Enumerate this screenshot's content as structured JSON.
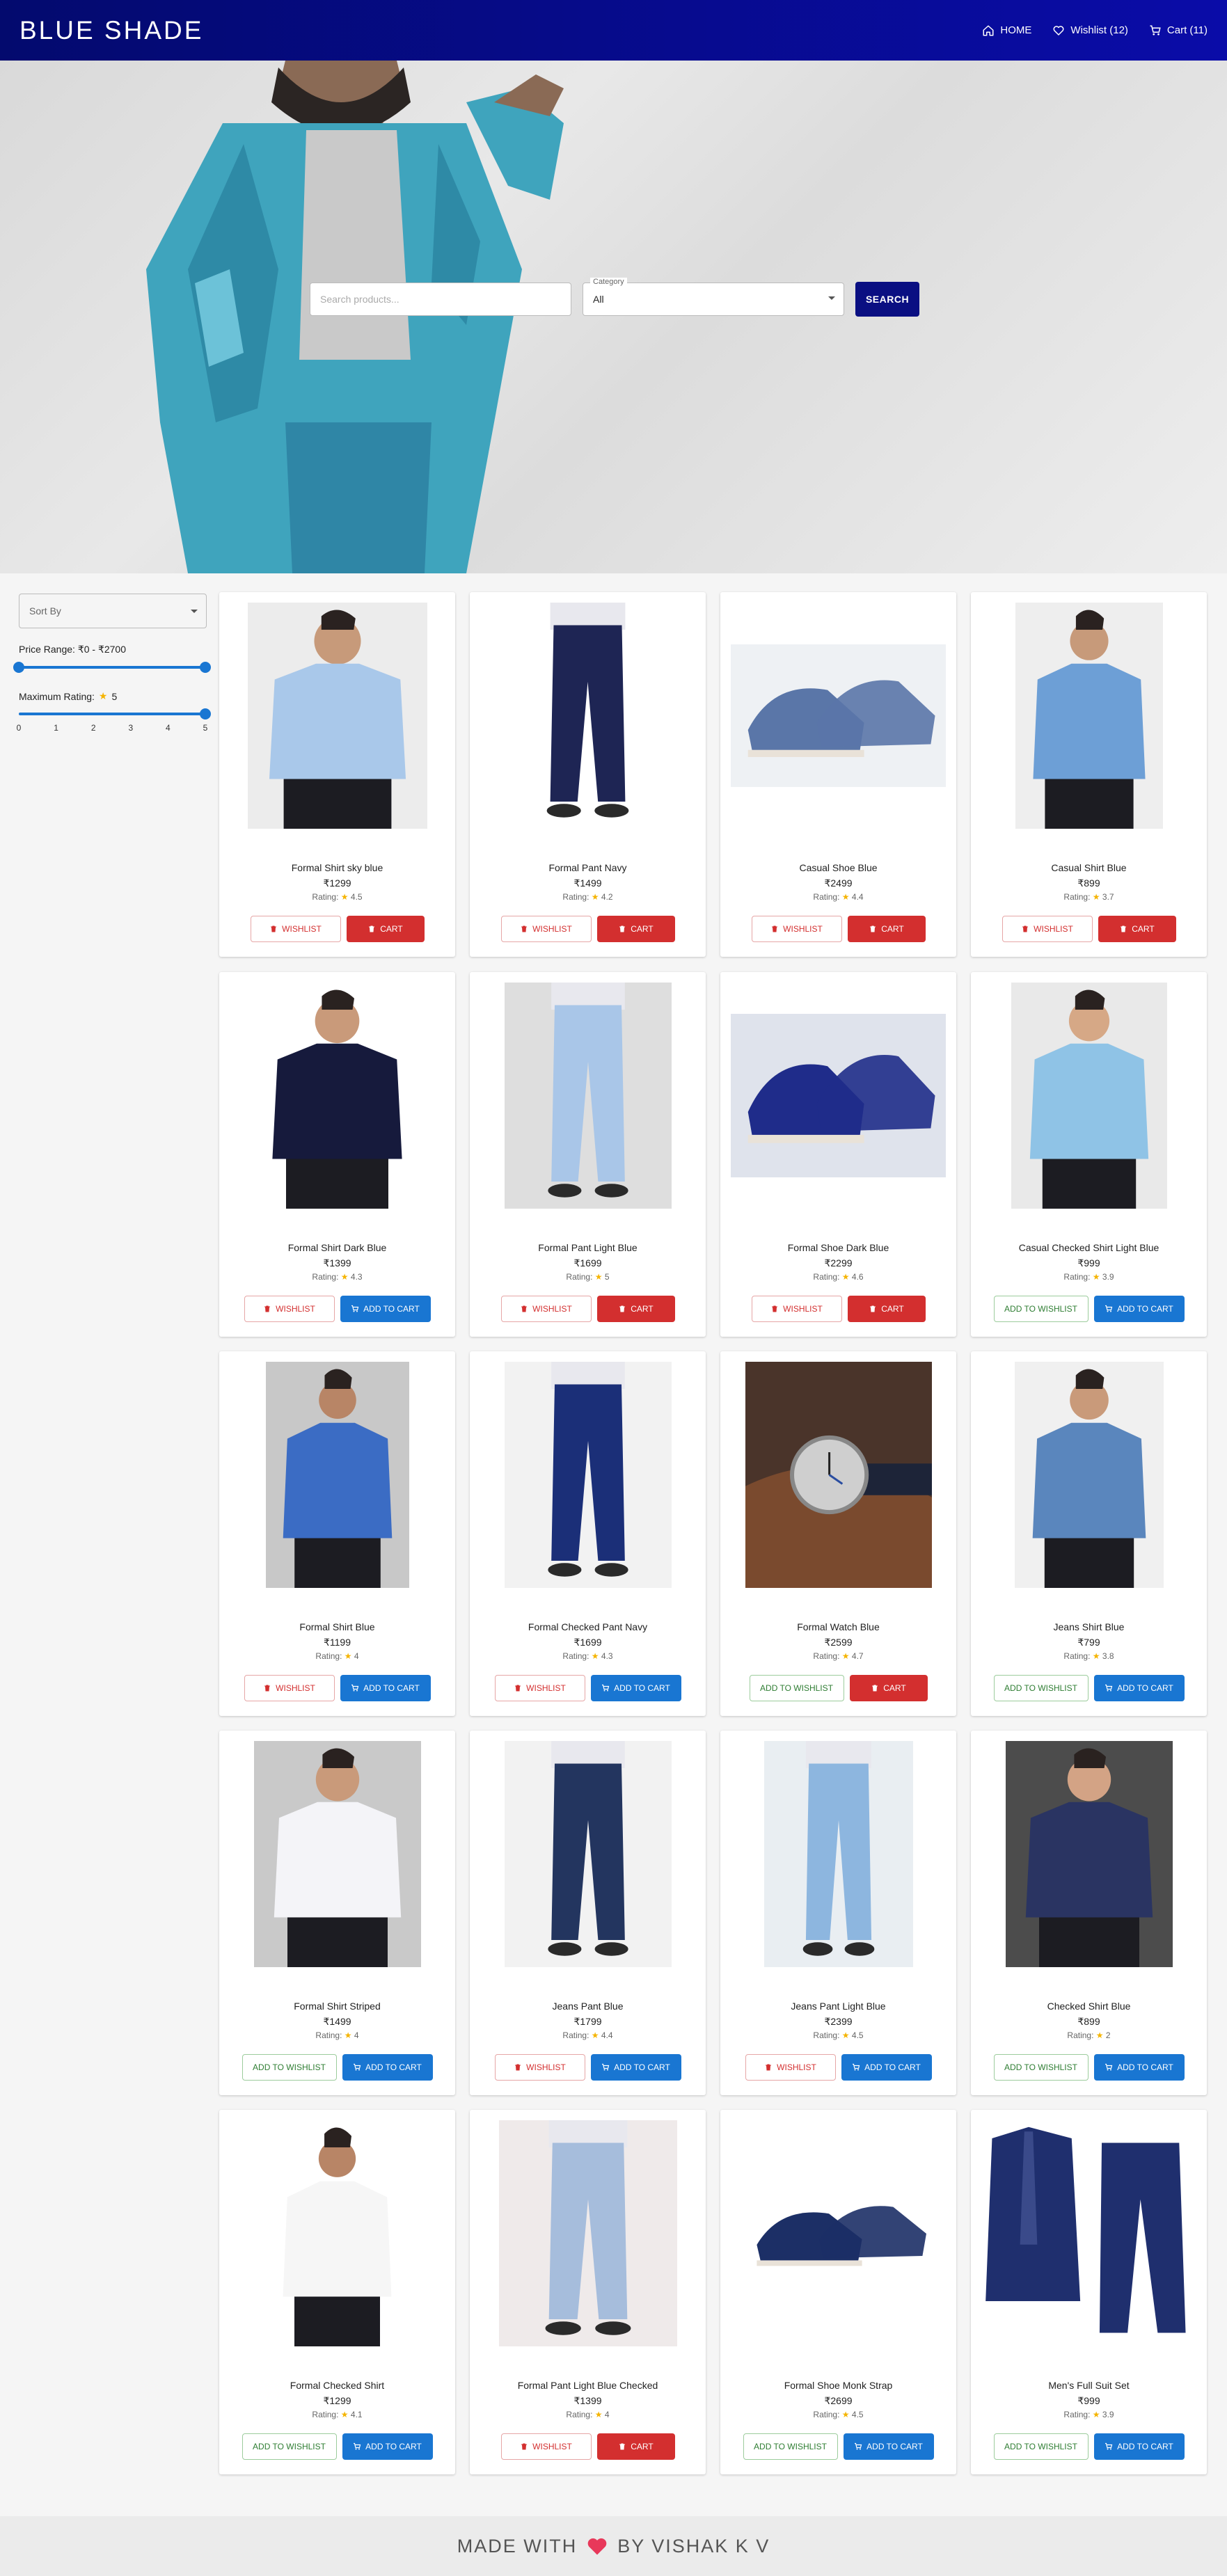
{
  "header": {
    "brand": "BLUE SHADE",
    "nav": [
      {
        "label": "HOME",
        "icon": "home-icon"
      },
      {
        "label": "Wishlist (12)",
        "icon": "heart-icon"
      },
      {
        "label": "Cart (11)",
        "icon": "cart-icon"
      }
    ]
  },
  "hero": {
    "search_placeholder": "Search products...",
    "category_label": "Category",
    "category_value": "All",
    "search_button": "SEARCH"
  },
  "filters": {
    "sort_placeholder": "Sort By",
    "price_label": "Price Range: ₹0 - ₹2700",
    "price_min": 0,
    "price_max": 2700,
    "rating_label": "Maximum Rating:",
    "rating_value": "5",
    "rating_marks": [
      "0",
      "1",
      "2",
      "3",
      "4",
      "5"
    ]
  },
  "products": [
    {
      "name": "Formal Shirt sky blue",
      "price": "₹1299",
      "rating": "4.5",
      "wish": "WISHLIST",
      "cart": "CART",
      "wish_state": "added",
      "cart_state": "added"
    },
    {
      "name": "Formal Pant Navy",
      "price": "₹1499",
      "rating": "4.2",
      "wish": "WISHLIST",
      "cart": "CART",
      "wish_state": "added",
      "cart_state": "added"
    },
    {
      "name": "Casual Shoe Blue",
      "price": "₹2499",
      "rating": "4.4",
      "wish": "WISHLIST",
      "cart": "CART",
      "wish_state": "added",
      "cart_state": "added"
    },
    {
      "name": "Casual Shirt Blue",
      "price": "₹899",
      "rating": "3.7",
      "wish": "WISHLIST",
      "cart": "CART",
      "wish_state": "added",
      "cart_state": "added"
    },
    {
      "name": "Formal Shirt Dark Blue",
      "price": "₹1399",
      "rating": "4.3",
      "wish": "WISHLIST",
      "cart": "ADD TO CART",
      "wish_state": "added",
      "cart_state": "add"
    },
    {
      "name": "Formal Pant Light Blue",
      "price": "₹1699",
      "rating": "5",
      "wish": "WISHLIST",
      "cart": "CART",
      "wish_state": "added",
      "cart_state": "added"
    },
    {
      "name": "Formal Shoe Dark Blue",
      "price": "₹2299",
      "rating": "4.6",
      "wish": "WISHLIST",
      "cart": "CART",
      "wish_state": "added",
      "cart_state": "added"
    },
    {
      "name": "Casual Checked Shirt Light Blue",
      "price": "₹999",
      "rating": "3.9",
      "wish": "ADD TO WISHLIST",
      "cart": "ADD TO CART",
      "wish_state": "add",
      "cart_state": "add"
    },
    {
      "name": "Formal Shirt Blue",
      "price": "₹1199",
      "rating": "4",
      "wish": "WISHLIST",
      "cart": "ADD TO CART",
      "wish_state": "added",
      "cart_state": "add"
    },
    {
      "name": "Formal Checked Pant Navy",
      "price": "₹1699",
      "rating": "4.3",
      "wish": "WISHLIST",
      "cart": "ADD TO CART",
      "wish_state": "added",
      "cart_state": "add"
    },
    {
      "name": "Formal Watch Blue",
      "price": "₹2599",
      "rating": "4.7",
      "wish": "ADD TO WISHLIST",
      "cart": "CART",
      "wish_state": "add",
      "cart_state": "added"
    },
    {
      "name": "Jeans Shirt Blue",
      "price": "₹799",
      "rating": "3.8",
      "wish": "ADD TO WISHLIST",
      "cart": "ADD TO CART",
      "wish_state": "add",
      "cart_state": "add"
    },
    {
      "name": "Formal Shirt Striped",
      "price": "₹1499",
      "rating": "4",
      "wish": "ADD TO WISHLIST",
      "cart": "ADD TO CART",
      "wish_state": "add",
      "cart_state": "add"
    },
    {
      "name": "Jeans Pant Blue",
      "price": "₹1799",
      "rating": "4.4",
      "wish": "WISHLIST",
      "cart": "ADD TO CART",
      "wish_state": "added",
      "cart_state": "add"
    },
    {
      "name": "Jeans Pant Light Blue",
      "price": "₹2399",
      "rating": "4.5",
      "wish": "WISHLIST",
      "cart": "ADD TO CART",
      "wish_state": "added",
      "cart_state": "add"
    },
    {
      "name": "Checked Shirt Blue",
      "price": "₹899",
      "rating": "2",
      "wish": "ADD TO WISHLIST",
      "cart": "ADD TO CART",
      "wish_state": "add",
      "cart_state": "add"
    },
    {
      "name": "Formal Checked Shirt",
      "price": "₹1299",
      "rating": "4.1",
      "wish": "ADD TO WISHLIST",
      "cart": "ADD TO CART",
      "wish_state": "add",
      "cart_state": "add"
    },
    {
      "name": "Formal Pant Light Blue Checked",
      "price": "₹1399",
      "rating": "4",
      "wish": "WISHLIST",
      "cart": "CART",
      "wish_state": "added",
      "cart_state": "added"
    },
    {
      "name": "Formal Shoe Monk Strap",
      "price": "₹2699",
      "rating": "4.5",
      "wish": "ADD TO WISHLIST",
      "cart": "ADD TO CART",
      "wish_state": "add",
      "cart_state": "add"
    },
    {
      "name": "Men's Full Suit Set",
      "price": "₹999",
      "rating": "3.9",
      "wish": "ADD TO WISHLIST",
      "cart": "ADD TO CART",
      "wish_state": "add",
      "cart_state": "add"
    }
  ],
  "rating_prefix": "Rating:",
  "footer": {
    "left": "MADE WITH",
    "right": "BY VISHAK K V"
  },
  "colors": {
    "header": "#0a0ca8",
    "danger": "#d32f2f",
    "primary": "#1976d2",
    "success": "#2e7d32"
  }
}
